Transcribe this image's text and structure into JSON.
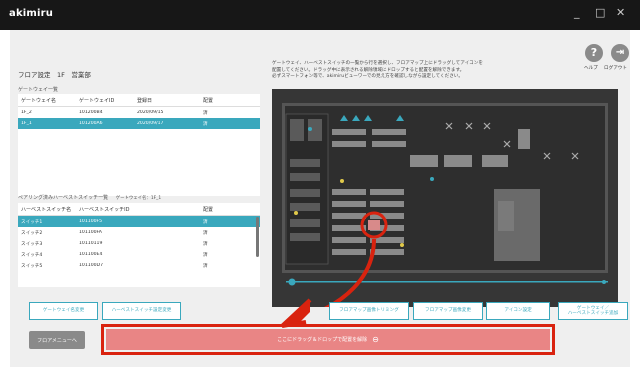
{
  "window": {
    "title": "akimiru",
    "minimize_glyph": "_",
    "maximize_glyph": "□",
    "close_glyph": "✕"
  },
  "page": {
    "title": "フロア設定　1F　営業部"
  },
  "instructions": {
    "line1": "ゲートウェイ、ハーベストスイッチの一覧から行を選択し、フロアマップ上にドラッグしてアイコンを",
    "line2": "配置してください。ドラッグ中に表示される解除領域にドロップすると配置を解除できます。",
    "line3": "必ずスマートフォン等で、akimiruビューワーでの見え方を確認しながら設定してください。"
  },
  "header_actions": {
    "help_label": "ヘルプ",
    "help_glyph": "?",
    "logout_label": "ログアウト",
    "logout_glyph": "⇥"
  },
  "gateway_list": {
    "heading": "ゲートウェイ一覧",
    "columns": [
      "ゲートウェイ名",
      "ゲートウェイID",
      "登録日",
      "配置"
    ],
    "rows": [
      [
        "1F_2",
        "101200B4",
        "2020/09/15",
        "済"
      ],
      [
        "1F_1",
        "101200A6",
        "2020/09/17",
        "済"
      ]
    ],
    "selected_index": 1
  },
  "switch_list": {
    "heading": "ペアリング済みハーベストスイッチ一覧",
    "subheading": "ゲートウェイ名：1F_1",
    "columns": [
      "ハーベストスイッチ名",
      "ハーベストスイッチID",
      "配置"
    ],
    "rows": [
      [
        "スイッチ1",
        "101100F5",
        "済"
      ],
      [
        "スイッチ2",
        "101100FA",
        "済"
      ],
      [
        "スイッチ3",
        "10110119",
        "済"
      ],
      [
        "スイッチ4",
        "101100E4",
        "済"
      ],
      [
        "スイッチ5",
        "101100D7",
        "済"
      ]
    ],
    "selected_index": 0
  },
  "buttons": {
    "gateway_change": "ゲートウェイ名変更",
    "switch_settings": "ハーベストスイッチ設定変更",
    "trim_map": "フロアマップ画像トリミング",
    "change_map": "フロアマップ画像変更",
    "icon_settings": "アイコン設定",
    "add_gateway_line1": "ゲートウェイ／",
    "add_gateway_line2": "ハーベストスイッチ追加",
    "floor_menu": "フロアメニューへ"
  },
  "drop_zone": {
    "label": "ここにドラッグ＆ドロップで配置を解除",
    "glyph": "⊖"
  },
  "colors": {
    "accent": "#3aa8bd",
    "drop_zone": "#e98585",
    "highlight": "#d9230f",
    "titlebar": "#171717",
    "map_bg": "#363636"
  }
}
